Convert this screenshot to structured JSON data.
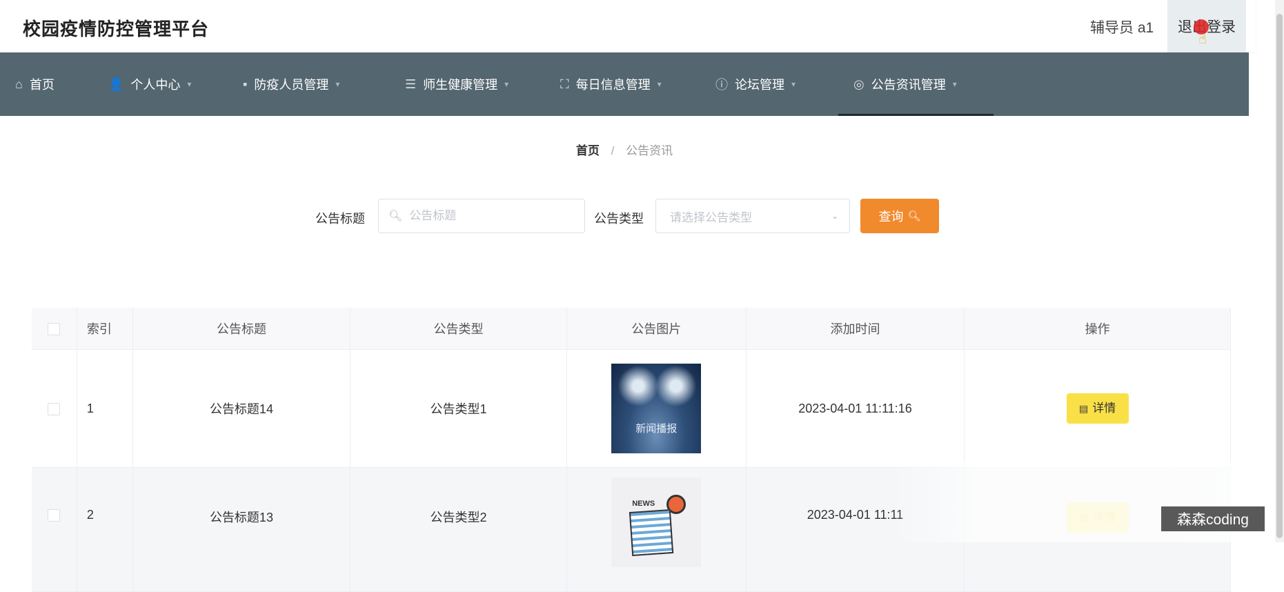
{
  "header": {
    "title": "校园疫情防控管理平台",
    "user_label": "辅导员 a1",
    "logout_label": "退出登录"
  },
  "nav": {
    "items": [
      {
        "label": "首页",
        "icon": "home-icon"
      },
      {
        "label": "个人中心",
        "icon": "user-icon"
      },
      {
        "label": "防疫人员管理",
        "icon": "briefcase-icon"
      },
      {
        "label": "师生健康管理",
        "icon": "list-icon"
      },
      {
        "label": "每日信息管理",
        "icon": "frame-icon"
      },
      {
        "label": "论坛管理",
        "icon": "info-icon"
      },
      {
        "label": "公告资讯管理",
        "icon": "target-icon"
      }
    ],
    "active": "公告资讯管理"
  },
  "breadcrumb": {
    "home": "首页",
    "separator": "/",
    "current": "公告资讯"
  },
  "search": {
    "title_label": "公告标题",
    "title_placeholder": "公告标题",
    "type_label": "公告类型",
    "type_placeholder": "请选择公告类型",
    "query_label": "查询"
  },
  "table": {
    "columns": [
      "索引",
      "公告标题",
      "公告类型",
      "公告图片",
      "添加时间",
      "操作"
    ],
    "rows": [
      {
        "index": "1",
        "title": "公告标题14",
        "type": "公告类型1",
        "image_caption": "新闻播报",
        "time": "2023-04-01 11:11:16",
        "action": "详情"
      },
      {
        "index": "2",
        "title": "公告标题13",
        "type": "公告类型2",
        "image_caption": "NEWS",
        "time": "2023-04-01 11:11",
        "action": "详情"
      }
    ]
  },
  "watermark": "森森coding",
  "colors": {
    "nav_bg": "#54666f",
    "query_button": "#f08a2c",
    "detail_button": "#fae047"
  }
}
